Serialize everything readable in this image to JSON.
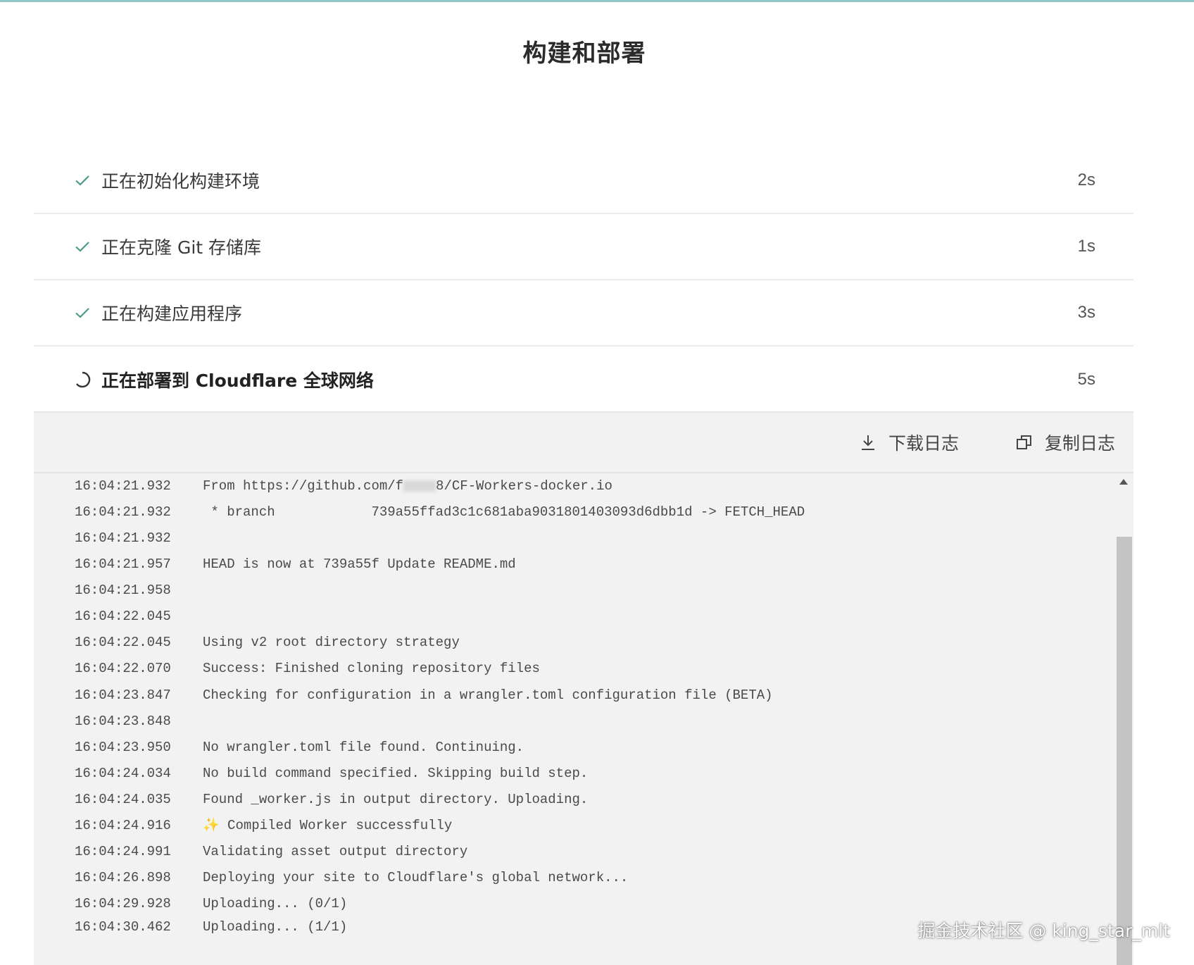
{
  "page": {
    "title": "构建和部署"
  },
  "steps": [
    {
      "label": "正在初始化构建环境",
      "time": "2s",
      "status": "done"
    },
    {
      "label": "正在克隆 Git 存储库",
      "time": "1s",
      "status": "done"
    },
    {
      "label": "正在构建应用程序",
      "time": "3s",
      "status": "done"
    },
    {
      "label": "正在部署到 Cloudflare 全球网络",
      "time": "5s",
      "status": "in-progress"
    }
  ],
  "log_toolbar": {
    "download_label": "下载日志",
    "copy_label": "复制日志"
  },
  "logs": [
    {
      "time": "16:04:21.932",
      "msg_a": "From https://github.com/f",
      "msg_b": "8/CF-Workers-docker.io"
    },
    {
      "time": "16:04:21.932",
      "msg": " * branch            739a55ffad3c1c681aba9031801403093d6dbb1d -> FETCH_HEAD"
    },
    {
      "time": "16:04:21.932",
      "msg": ""
    },
    {
      "time": "16:04:21.957",
      "msg": "HEAD is now at 739a55f Update README.md"
    },
    {
      "time": "16:04:21.958",
      "msg": ""
    },
    {
      "time": "16:04:22.045",
      "msg": ""
    },
    {
      "time": "16:04:22.045",
      "msg": "Using v2 root directory strategy"
    },
    {
      "time": "16:04:22.070",
      "msg": "Success: Finished cloning repository files"
    },
    {
      "time": "16:04:23.847",
      "msg": "Checking for configuration in a wrangler.toml configuration file (BETA)"
    },
    {
      "time": "16:04:23.848",
      "msg": ""
    },
    {
      "time": "16:04:23.950",
      "msg": "No wrangler.toml file found. Continuing."
    },
    {
      "time": "16:04:24.034",
      "msg": "No build command specified. Skipping build step."
    },
    {
      "time": "16:04:24.035",
      "msg": "Found _worker.js in output directory. Uploading."
    },
    {
      "time": "16:04:24.916",
      "msg": "✨ Compiled Worker successfully"
    },
    {
      "time": "16:04:24.991",
      "msg": "Validating asset output directory"
    },
    {
      "time": "16:04:26.898",
      "msg": "Deploying your site to Cloudflare's global network..."
    },
    {
      "time": "16:04:29.928",
      "msg": "Uploading... (0/1)"
    },
    {
      "time": "16:04:30.462",
      "msg": "Uploading... (1/1)"
    }
  ],
  "watermark": "掘金技术社区 @ king_star_mlt",
  "colors": {
    "check": "#4a9a8a",
    "accent_bar": "#8fc8c4",
    "log_bg": "#f2f2f2"
  }
}
